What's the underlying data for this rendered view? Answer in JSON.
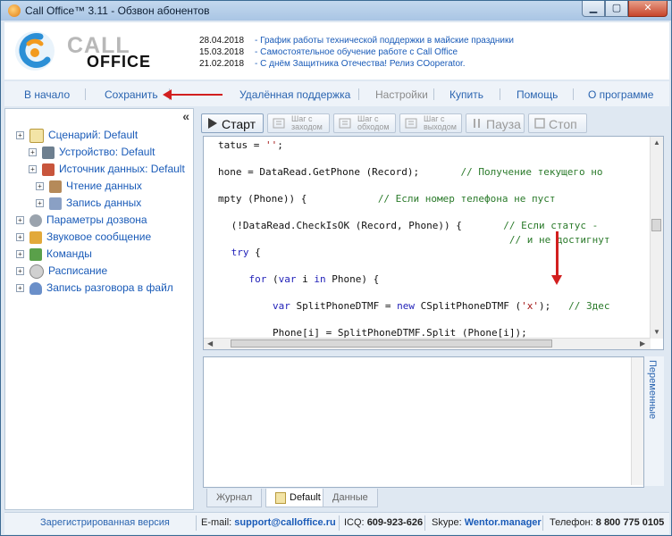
{
  "window": {
    "title": "Call Office™ 3.11 - Обзвон абонентов",
    "min": "▁",
    "max": "▢",
    "close": "✕"
  },
  "logo": {
    "call": "CALL",
    "office": "OFFICE"
  },
  "news": [
    {
      "date": "28.04.2018",
      "text": "- График работы технической поддержки в майские праздники"
    },
    {
      "date": "15.03.2018",
      "text": "- Самостоятельное обучение работе с Call Office"
    },
    {
      "date": "21.02.2018",
      "text": "- С днём Защитника Отечества! Релиз COoperator."
    }
  ],
  "menu": {
    "home": "В начало",
    "save": "Сохранить",
    "remote": "Удалённая поддержка",
    "settings": "Настройки",
    "buy": "Купить",
    "help": "Помощь",
    "about": "О программе"
  },
  "tree": [
    {
      "label": "Сценарий: Default",
      "icon": "script-icon"
    },
    {
      "label": "Устройство: Default",
      "icon": "device-icon"
    },
    {
      "label": "Источник данных: Default",
      "icon": "database-icon"
    },
    {
      "label": "Чтение данных",
      "icon": "read-data-icon"
    },
    {
      "label": "Запись данных",
      "icon": "write-data-icon"
    },
    {
      "label": "Параметры дозвона",
      "icon": "gear-icon"
    },
    {
      "label": "Звуковое сообщение",
      "icon": "speaker-icon"
    },
    {
      "label": "Команды",
      "icon": "commands-icon"
    },
    {
      "label": "Расписание",
      "icon": "clock-icon"
    },
    {
      "label": "Запись разговора в файл",
      "icon": "microphone-icon"
    }
  ],
  "toolbar": {
    "start": "Старт",
    "step_in_1": "Шаг с",
    "step_in_2": "заходом",
    "step_over_1": "Шаг с",
    "step_over_2": "обходом",
    "step_out_1": "Шаг с",
    "step_out_2": "выходом",
    "pause": "Пауза",
    "stop": "Стоп"
  },
  "code": [
    {
      "parts": [
        {
          "t": "tatus = ",
          "c": ""
        },
        {
          "t": "''",
          "c": "st"
        },
        {
          "t": ";",
          "c": ""
        }
      ]
    },
    {
      "parts": [
        {
          "t": "hone = DataRead.GetPhone (Record);       ",
          "c": ""
        },
        {
          "t": "// Получение текущего но",
          "c": "cm"
        }
      ]
    },
    {
      "parts": [
        {
          "t": "mpty (Phone)) {            ",
          "c": ""
        },
        {
          "t": "// Если номер телефона не пуст",
          "c": "cm"
        }
      ]
    },
    {
      "parts": [
        {
          "t": " (!DataRead.CheckIsOK (Record, Phone)) {       ",
          "c": ""
        },
        {
          "t": "// Если статус -",
          "c": "cm"
        }
      ]
    },
    {
      "parts": [
        {
          "t": "                                                ",
          "c": ""
        },
        {
          "t": "// и не достигнут",
          "c": "cm"
        }
      ]
    },
    {
      "parts": [
        {
          "t": " ",
          "c": ""
        },
        {
          "t": "try",
          "c": "kw"
        },
        {
          "t": " {",
          "c": ""
        }
      ]
    },
    {
      "parts": [
        {
          "t": "    ",
          "c": ""
        },
        {
          "t": "for",
          "c": "kw"
        },
        {
          "t": " (",
          "c": ""
        },
        {
          "t": "var",
          "c": "kw"
        },
        {
          "t": " i ",
          "c": ""
        },
        {
          "t": "in",
          "c": "kw"
        },
        {
          "t": " Phone) {",
          "c": ""
        }
      ]
    },
    {
      "parts": [
        {
          "t": "        ",
          "c": ""
        },
        {
          "t": "var",
          "c": "kw"
        },
        {
          "t": " SplitPhoneDTMF = ",
          "c": ""
        },
        {
          "t": "new",
          "c": "kw"
        },
        {
          "t": " CSplitPhoneDTMF (",
          "c": ""
        },
        {
          "t": "'x'",
          "c": "st"
        },
        {
          "t": ");   ",
          "c": ""
        },
        {
          "t": "// Здес",
          "c": "cm"
        }
      ]
    },
    {
      "parts": [
        {
          "t": "        Phone[i] = SplitPhoneDTMF.Split (Phone[i]);",
          "c": ""
        }
      ]
    }
  ],
  "side_tab": "Переменные",
  "tabs": [
    "Журнал",
    "Default",
    "Данные"
  ],
  "status": {
    "registered": "Зарегистрированная версия",
    "email_label": "E-mail:",
    "email": "support@calloffice.ru",
    "icq_label": "ICQ:",
    "icq": "609-923-626",
    "skype_label": "Skype:",
    "skype": "Wentor.manager",
    "phone_label": "Телефон:",
    "phone": "8 800 775 0105"
  }
}
